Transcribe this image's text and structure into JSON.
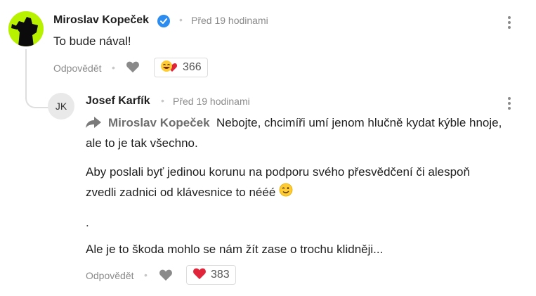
{
  "comment": {
    "author": "Miroslav Kopeček",
    "time": "Před 19 hodinami",
    "text": "To bude nával!",
    "reply_label": "Odpovědět",
    "reaction_count": "366",
    "reaction_icon": "laughing-heart-emoji-icon"
  },
  "reply": {
    "avatar_initials": "JK",
    "author": "Josef Karfík",
    "time": "Před 19 hodinami",
    "mention": "Miroslav Kopeček",
    "lines": [
      "Nebojte, chcimíři umí jenom hlučně kydat kýble hnoje,",
      "ale to je tak všechno.",
      "Aby poslali byť jedinou korunu na podporu svého přesvědčení či alespoň",
      "zvedli zadnici od klávesnice to nééé",
      ".",
      "Ale je to škoda mohlo se nám žít zase o trochu klidněji..."
    ],
    "reply_label": "Odpovědět",
    "reaction_count": "383",
    "reaction_icon": "red-heart-icon"
  },
  "colors": {
    "verified": "#2d8cf0",
    "heart_red": "#e0243a",
    "avatar_bg": "#b9f200"
  }
}
